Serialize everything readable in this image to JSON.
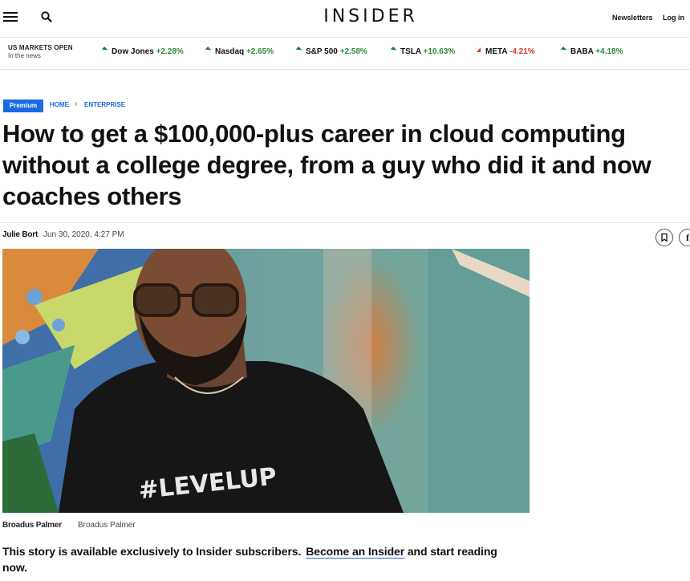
{
  "header": {
    "logo": "INSIDER",
    "newsletters_label": "Newsletters",
    "login_label": "Log in"
  },
  "markets": {
    "status": "US MARKETS OPEN",
    "substatus": "In the news",
    "tickers": [
      {
        "name": "Dow Jones",
        "change": "+2.28%",
        "direction": "up"
      },
      {
        "name": "Nasdaq",
        "change": "+2.65%",
        "direction": "up"
      },
      {
        "name": "S&P 500",
        "change": "+2.58%",
        "direction": "up"
      },
      {
        "name": "TSLA",
        "change": "+10.63%",
        "direction": "up"
      },
      {
        "name": "META",
        "change": "-4.21%",
        "direction": "down"
      },
      {
        "name": "BABA",
        "change": "+4.18%",
        "direction": "up"
      }
    ]
  },
  "breadcrumb": {
    "badge": "Premium",
    "home": "HOME",
    "separator": "›",
    "section": "ENTERPRISE"
  },
  "article": {
    "headline": "How to get a $100,000-plus career in cloud computing without a college degree, from a guy who did it and now coaches others",
    "author": "Julie Bort",
    "date": "Jun 30, 2020, 4:27 PM",
    "image_shirt_text": "#LEVELUP",
    "image_credit": "Broadus Palmer",
    "image_caption": "Broadus Palmer",
    "paywall_text": "This story is available exclusively to Insider subscribers.",
    "paywall_link": "Become an Insider",
    "paywall_tail": " and start reading now."
  },
  "icons": {
    "menu": "hamburger-menu-icon",
    "search": "search-icon",
    "save": "bookmark-icon",
    "share": "facebook-icon"
  },
  "colors": {
    "accent_blue": "#1a6be0",
    "up_green": "#2e8b3d",
    "down_red": "#d93a2b"
  }
}
